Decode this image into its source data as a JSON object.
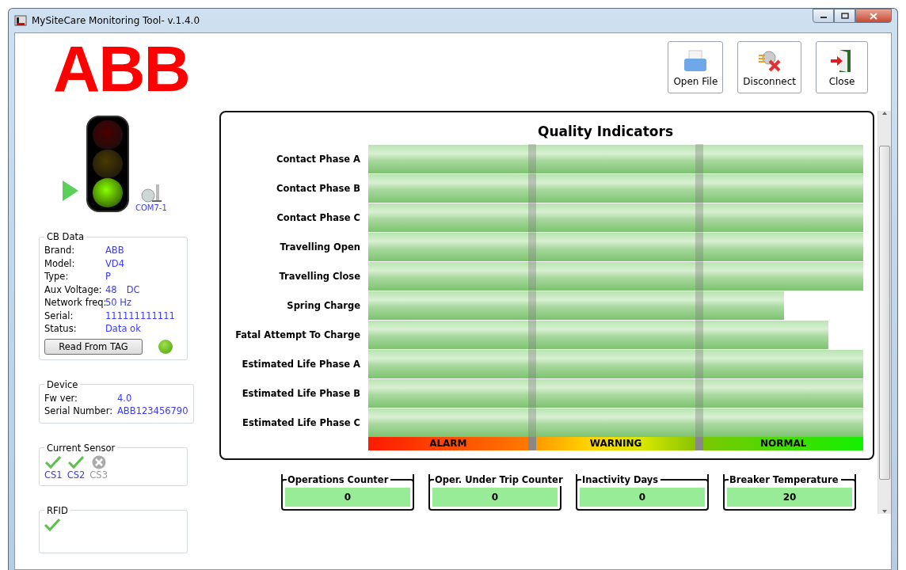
{
  "window": {
    "title": "MySiteCare Monitoring Tool- v.1.4.0"
  },
  "logo": {
    "text": "ABB"
  },
  "connection": {
    "lights": [
      {
        "on": false
      },
      {
        "on": false
      },
      {
        "on": true
      }
    ],
    "port": "COM7-1"
  },
  "toolbar": [
    {
      "label": "Open File",
      "kind": "open"
    },
    {
      "label": "Disconnect",
      "kind": "disconnect"
    },
    {
      "label": "Close",
      "kind": "exit"
    }
  ],
  "cb_data": {
    "title": "CB Data",
    "fields": [
      {
        "label": "Brand:",
        "value": "ABB"
      },
      {
        "label": "Model:",
        "value": "VD4"
      },
      {
        "label": "Type:",
        "value": "P"
      },
      {
        "label": "Aux Voltage:",
        "value": "48",
        "unit": "DC"
      },
      {
        "label": "Network freq:",
        "value": "50 Hz"
      },
      {
        "label": "Serial:",
        "value": "111111111111"
      },
      {
        "label": "Status:",
        "value": "Data ok"
      }
    ],
    "button": "Read From TAG",
    "led_on": true
  },
  "device": {
    "title": "Device",
    "fields": [
      {
        "label": "Fw ver:",
        "value": "4.0"
      },
      {
        "label": "Serial Number:",
        "value": "ABB123456790"
      }
    ]
  },
  "current_sensor": {
    "title": "Current Sensor",
    "sensors": [
      {
        "label": "CS1",
        "ok": true
      },
      {
        "label": "CS2",
        "ok": true
      },
      {
        "label": "CS3",
        "ok": false
      }
    ]
  },
  "rfid": {
    "title": "RFID",
    "ok": true
  },
  "quality_indicators": {
    "title": "Quality Indicators",
    "rows": [
      {
        "label": "Contact Phase A",
        "level": 1
      },
      {
        "label": "Contact Phase B",
        "level": 1
      },
      {
        "label": "Contact Phase C",
        "level": 1
      },
      {
        "label": "Travelling Open",
        "level": 1
      },
      {
        "label": "Travelling Close",
        "level": 1
      },
      {
        "label": "Spring Charge",
        "level": 0.84
      },
      {
        "label": "Fatal Attempt To Charge",
        "level": 0.93
      },
      {
        "label": "Estimated Life Phase A",
        "level": 1
      },
      {
        "label": "Estimated Life Phase B",
        "level": 1
      },
      {
        "label": "Estimated Life Phase C",
        "level": 1
      }
    ],
    "scale": [
      {
        "label": "ALARM",
        "kind": "alarm"
      },
      {
        "label": "WARNING",
        "kind": "warning"
      },
      {
        "label": "NORMAL",
        "kind": "normal"
      }
    ]
  },
  "counters": [
    {
      "label": "Operations Counter",
      "value": "0"
    },
    {
      "label": "Oper. Under Trip Counter",
      "value": "0"
    },
    {
      "label": "Inactivity Days",
      "value": "0"
    },
    {
      "label": "Breaker Temperature",
      "value": "20"
    }
  ]
}
